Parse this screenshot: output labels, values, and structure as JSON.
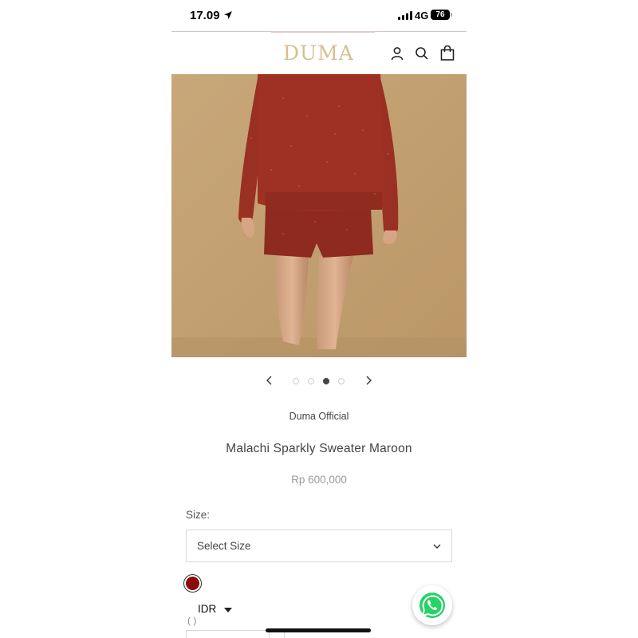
{
  "status_bar": {
    "time": "17.09",
    "network": "4G",
    "battery": "76"
  },
  "header": {
    "logo": "DUMA",
    "icons": [
      "account-icon",
      "search-icon",
      "cart-icon"
    ]
  },
  "carousel": {
    "image_count": 4,
    "active_index": 2
  },
  "product": {
    "vendor": "Duma Official",
    "title": "Malachi Sparkly Sweater Maroon",
    "price": "Rp 600,000"
  },
  "options": {
    "size_label": "Size:",
    "size_placeholder": "Select Size",
    "color_swatch": "#8b0a0a"
  },
  "footer": {
    "currency": "IDR",
    "partial_label": "( )"
  },
  "colors": {
    "logo": "#d8bf8f",
    "whatsapp": "#25d366"
  }
}
